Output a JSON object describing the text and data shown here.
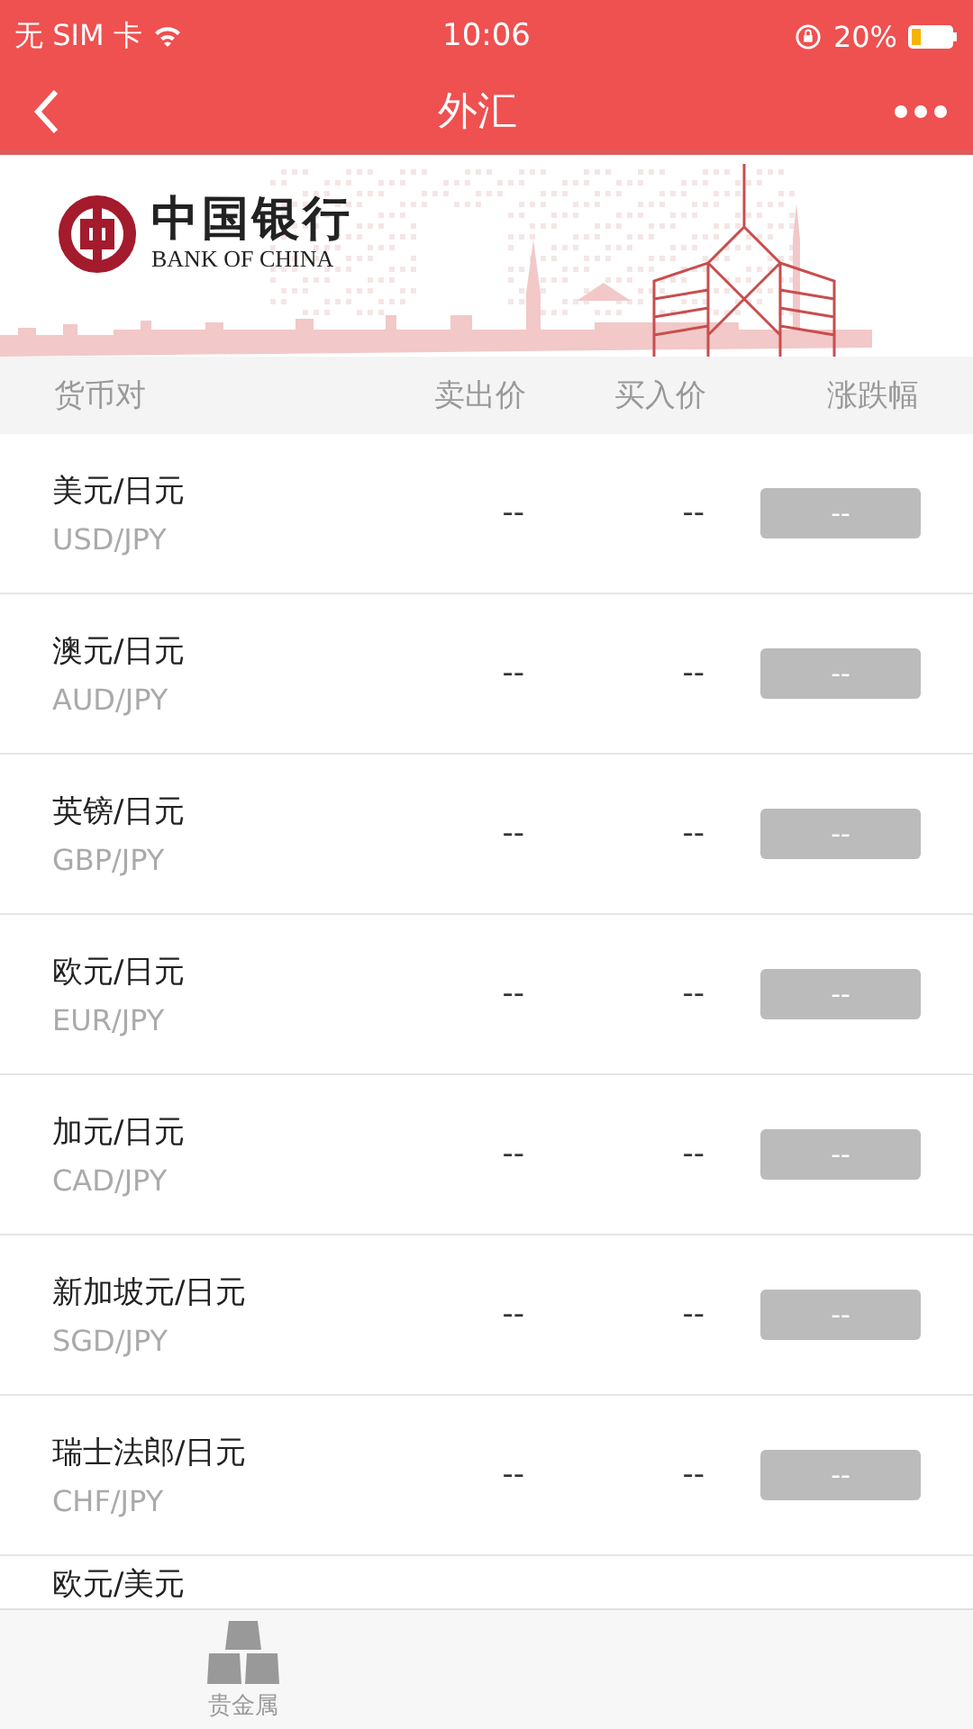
{
  "status_bar": {
    "carrier": "无 SIM 卡",
    "time": "10:06",
    "battery": "20%"
  },
  "nav": {
    "title": "外汇"
  },
  "banner": {
    "bank_name": "中国银行",
    "bank_name_en": "BANK OF CHINA"
  },
  "table": {
    "columns": [
      "货币对",
      "卖出价",
      "买入价",
      "涨跌幅"
    ],
    "rows": [
      {
        "name": "美元/日元",
        "code": "USD/JPY",
        "sell": "--",
        "buy": "--",
        "change": "--"
      },
      {
        "name": "澳元/日元",
        "code": "AUD/JPY",
        "sell": "--",
        "buy": "--",
        "change": "--"
      },
      {
        "name": "英镑/日元",
        "code": "GBP/JPY",
        "sell": "--",
        "buy": "--",
        "change": "--"
      },
      {
        "name": "欧元/日元",
        "code": "EUR/JPY",
        "sell": "--",
        "buy": "--",
        "change": "--"
      },
      {
        "name": "加元/日元",
        "code": "CAD/JPY",
        "sell": "--",
        "buy": "--",
        "change": "--"
      },
      {
        "name": "新加坡元/日元",
        "code": "SGD/JPY",
        "sell": "--",
        "buy": "--",
        "change": "--"
      },
      {
        "name": "瑞士法郎/日元",
        "code": "CHF/JPY",
        "sell": "--",
        "buy": "--",
        "change": "--"
      }
    ],
    "partial_row": {
      "name": "欧元/美元"
    }
  },
  "tab_bar": [
    {
      "label": "贵金属",
      "selected": false
    }
  ]
}
